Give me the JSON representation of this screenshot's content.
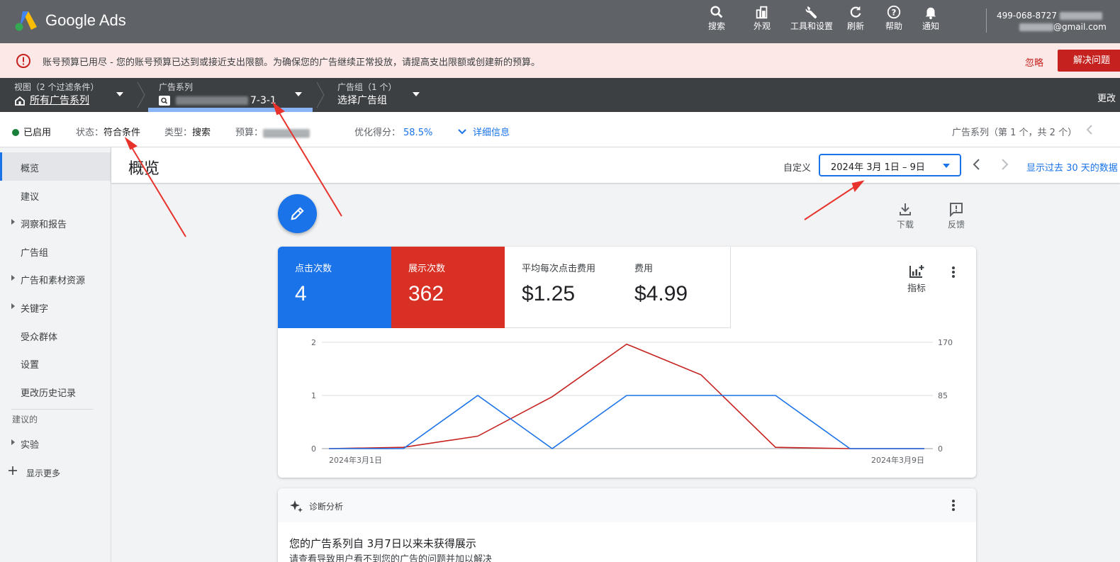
{
  "app": {
    "title": "Google Ads"
  },
  "topbar": {
    "actions": [
      {
        "label": "搜索",
        "icon": "search-icon"
      },
      {
        "label": "外观",
        "icon": "appearance-icon"
      },
      {
        "label": "工具和设置",
        "icon": "wrench-icon"
      },
      {
        "label": "刷新",
        "icon": "refresh-icon"
      },
      {
        "label": "帮助",
        "icon": "help-icon"
      },
      {
        "label": "通知",
        "icon": "bell-icon"
      }
    ],
    "account_id": "499-068-8727",
    "account_email": "@gmail.com"
  },
  "alert": {
    "text": "账号预算已用尽 - 您的账号预算已达到或接近支出限额。为确保您的广告继续正常投放，请提高支出限额或创建新的预算。",
    "ignore": "忽略",
    "fix": "解决问题"
  },
  "crumbs": {
    "view_label": "视图（2 个过滤条件）",
    "view_value": "所有广告系列",
    "campaign_label": "广告系列",
    "campaign_value_suffix": "7-3-1",
    "adgroup_label": "广告组（1 个）",
    "adgroup_value": "选择广告组",
    "right_text": "更改"
  },
  "status": {
    "enabled": "已启用",
    "state_label": "状态：",
    "state_value": "符合条件",
    "type_label": "类型：",
    "type_value": "搜索",
    "budget_label": "预算：",
    "opt_label": "优化得分：",
    "opt_value": "58.5%",
    "details": "详细信息",
    "campaign_pos": "广告系列（第 1 个，共 2 个）"
  },
  "sidebar": {
    "items": [
      {
        "label": "概览",
        "expandable": false,
        "active": true
      },
      {
        "label": "建议",
        "expandable": false
      },
      {
        "label": "洞察和报告",
        "expandable": true
      },
      {
        "label": "广告组",
        "expandable": false
      },
      {
        "label": "广告和素材资源",
        "expandable": true
      },
      {
        "label": "关键字",
        "expandable": true
      },
      {
        "label": "受众群体",
        "expandable": false
      },
      {
        "label": "设置",
        "expandable": false
      },
      {
        "label": "更改历史记录",
        "expandable": false
      }
    ],
    "suggested_header": "建议的",
    "experiments": "实验",
    "show_more": "显示更多"
  },
  "page": {
    "title": "概览",
    "date_label": "自定义",
    "date_value": "2024年 3月 1日 – 9日",
    "show30": "显示过去 30 天的数据",
    "download": "下载",
    "feedback": "反馈"
  },
  "metrics": [
    {
      "label": "点击次数",
      "value": "4",
      "color": "#1a73e8"
    },
    {
      "label": "展示次数",
      "value": "362",
      "color": "#d93025"
    },
    {
      "label": "平均每次点击费用",
      "value": "$1.25"
    },
    {
      "label": "费用",
      "value": "$4.99"
    }
  ],
  "metrics_button": "指标",
  "chart_data": {
    "type": "line",
    "x": [
      "2024-03-01",
      "2024-03-02",
      "2024-03-03",
      "2024-03-04",
      "2024-03-05",
      "2024-03-06",
      "2024-03-07",
      "2024-03-08",
      "2024-03-09"
    ],
    "x_tick_labels": [
      "2024年3月1日",
      "2024年3月9日"
    ],
    "series": [
      {
        "name": "点击次数",
        "axis": "left",
        "color": "#1a73e8",
        "values": [
          0,
          0,
          1,
          0,
          1,
          1,
          1,
          0,
          0
        ]
      },
      {
        "name": "展示次数",
        "axis": "right",
        "color": "#c5221f",
        "values": [
          0,
          2,
          20,
          83,
          167,
          118,
          2,
          0,
          0
        ]
      }
    ],
    "left_axis": {
      "ticks": [
        "0",
        "1",
        "2"
      ],
      "ylim": [
        0,
        2
      ]
    },
    "right_axis": {
      "ticks": [
        "0",
        "85",
        "170"
      ],
      "ylim": [
        0,
        170
      ]
    },
    "grid": true
  },
  "diagnostics": {
    "title": "诊断分析",
    "headline": "您的广告系列自 3月7日以来未获得展示",
    "subtext": "请查看导致用户看不到您的广告的问题并加以解决"
  }
}
